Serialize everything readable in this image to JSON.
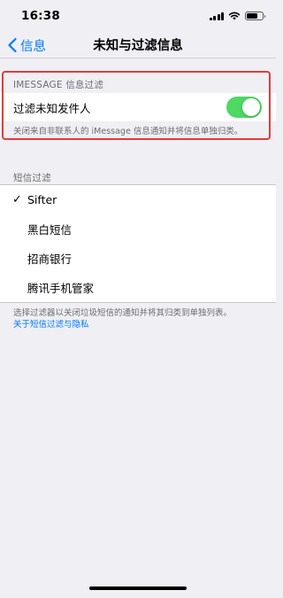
{
  "status_bar": {
    "time": "16:38"
  },
  "nav": {
    "back_label": "信息",
    "title": "未知与过滤信息"
  },
  "imessage_section": {
    "header": "IMESSAGE 信息过滤",
    "toggle_label": "过滤未知发件人",
    "toggle_on": true,
    "footer": "关闭来自非联系人的 iMessage 信息通知并将信息单独归类。"
  },
  "sms_section": {
    "header": "短信过滤",
    "items": [
      {
        "label": "Sifter",
        "selected": true
      },
      {
        "label": "黑白短信",
        "selected": false
      },
      {
        "label": "招商银行",
        "selected": false
      },
      {
        "label": "腾讯手机管家",
        "selected": false
      }
    ],
    "footer": "选择过滤器以关闭垃圾短信的通知并将其归类到单独列表。",
    "footer_link": "关于短信过滤与隐私"
  },
  "colors": {
    "accent": "#007aff",
    "toggle_on": "#4cd964",
    "highlight": "#e03c3c",
    "background": "#efeff4"
  }
}
